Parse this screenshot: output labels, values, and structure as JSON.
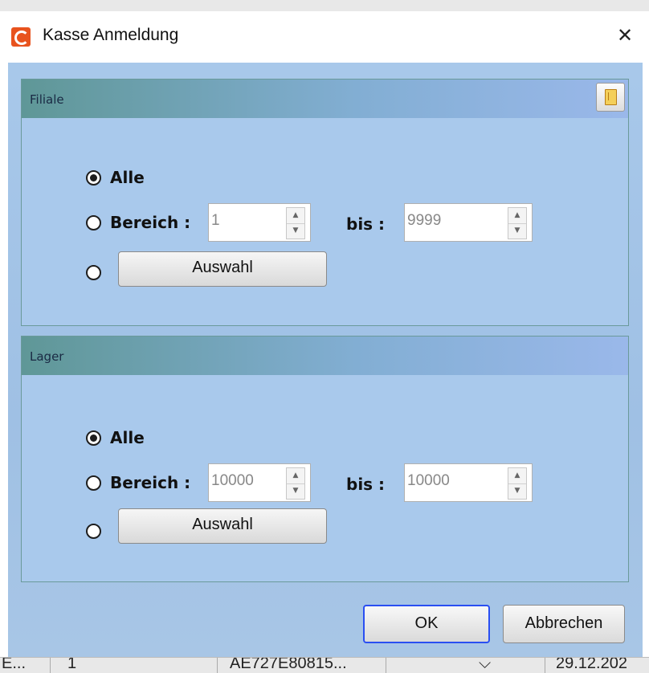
{
  "background": {
    "bottom_cells": [
      "E...",
      "1",
      "AE727E80815...",
      "29.12.202"
    ]
  },
  "window": {
    "title": "Kasse Anmeldung",
    "close_glyph": "✕"
  },
  "filiale": {
    "title": "Filiale",
    "alle_label": "Alle",
    "bereich_label": "Bereich :",
    "from_value": "1",
    "bis_label": "bis :",
    "to_value": "9999",
    "auswahl_label": "Auswahl",
    "selected": "alle"
  },
  "lager": {
    "title": "Lager",
    "alle_label": "Alle",
    "bereich_label": "Bereich :",
    "from_value": "10000",
    "bis_label": "bis :",
    "to_value": "10000",
    "auswahl_label": "Auswahl",
    "selected": "alle"
  },
  "footer": {
    "ok_label": "OK",
    "cancel_label": "Abbrechen"
  },
  "icons": {
    "app": "app-logo-icon",
    "book": "book-icon",
    "close": "close-icon"
  },
  "colors": {
    "dialog_bg": "#a9c9ec",
    "header_start": "#5f9797",
    "header_end": "#9ab8ea",
    "ok_border": "#2a4ff2",
    "app_icon": "#e8531e"
  }
}
